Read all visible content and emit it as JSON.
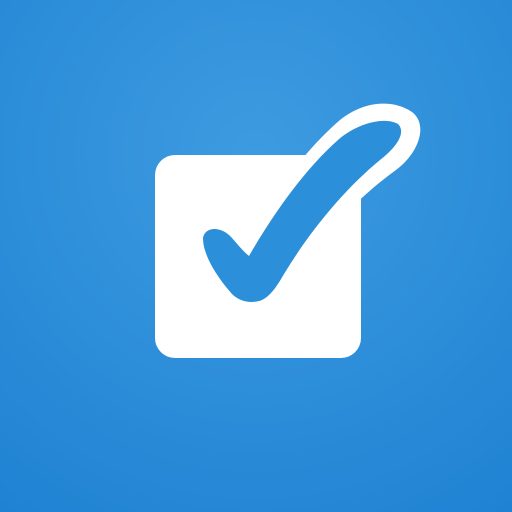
{
  "app_icon": {
    "icon_name": "checkbox-checked-icon",
    "colors": {
      "background_light": "#3d9be0",
      "background_dark": "#1f82d3",
      "symbol": "#ffffff",
      "check": "#2c8fd9"
    }
  }
}
